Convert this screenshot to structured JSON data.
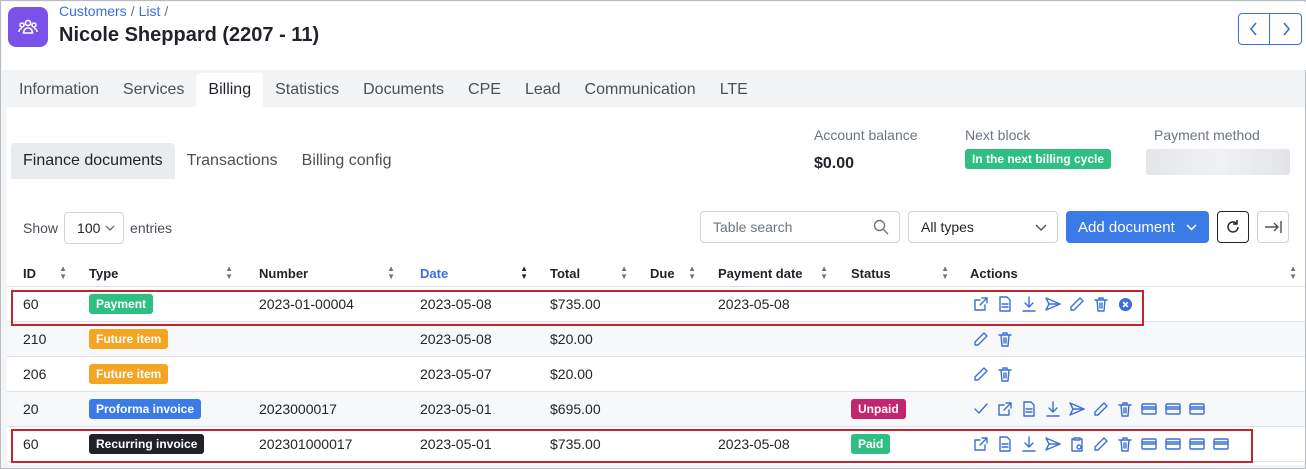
{
  "breadcrumb": [
    "Customers",
    "List"
  ],
  "page_title": "Nicole Sheppard (2207 - 11)",
  "tabs": [
    {
      "label": "Information",
      "active": false
    },
    {
      "label": "Services",
      "active": false
    },
    {
      "label": "Billing",
      "active": true
    },
    {
      "label": "Statistics",
      "active": false
    },
    {
      "label": "Documents",
      "active": false
    },
    {
      "label": "CPE",
      "active": false
    },
    {
      "label": "Lead",
      "active": false
    },
    {
      "label": "Communication",
      "active": false
    },
    {
      "label": "LTE",
      "active": false
    }
  ],
  "subtabs": [
    {
      "label": "Finance documents",
      "active": true
    },
    {
      "label": "Transactions",
      "active": false
    },
    {
      "label": "Billing config",
      "active": false
    }
  ],
  "account": {
    "balance_label": "Account balance",
    "balance": "$0.00",
    "next_block_label": "Next block",
    "next_block": "In the next billing cycle",
    "payment_method_label": "Payment method"
  },
  "controls": {
    "show": "Show",
    "entries_value": "100",
    "entries": "entries",
    "search_placeholder": "Table search",
    "type_select": "All types",
    "add_document": "Add document"
  },
  "columns": [
    "ID",
    "Type",
    "Number",
    "Date",
    "Total",
    "Due",
    "Payment date",
    "Status",
    "Actions"
  ],
  "rows": [
    {
      "id": "60",
      "type": "Payment",
      "type_color": "#2fbf82",
      "number": "2023-01-00004",
      "date": "2023-05-08",
      "total": "$735.00",
      "due": "",
      "payment_date": "2023-05-08",
      "status": "",
      "status_color": "",
      "actions": [
        "external-link-icon",
        "pdf-icon",
        "download-icon",
        "send-icon",
        "edit-icon",
        "delete-icon",
        "cancel-circle-icon"
      ],
      "highlighted": true
    },
    {
      "id": "210",
      "type": "Future item",
      "type_color": "#f5a524",
      "number": "",
      "date": "2023-05-08",
      "total": "$20.00",
      "due": "",
      "payment_date": "",
      "status": "",
      "status_color": "",
      "actions": [
        "edit-icon",
        "delete-icon"
      ],
      "highlighted": false
    },
    {
      "id": "206",
      "type": "Future item",
      "type_color": "#f5a524",
      "number": "",
      "date": "2023-05-07",
      "total": "$20.00",
      "due": "",
      "payment_date": "",
      "status": "",
      "status_color": "",
      "actions": [
        "edit-icon",
        "delete-icon"
      ],
      "highlighted": false
    },
    {
      "id": "20",
      "type": "Proforma invoice",
      "type_color": "#3b7be8",
      "number": "2023000017",
      "date": "2023-05-01",
      "total": "$695.00",
      "due": "",
      "payment_date": "",
      "status": "Unpaid",
      "status_color": "#c2266e",
      "actions": [
        "check-icon",
        "external-link-icon",
        "pdf-icon",
        "download-icon",
        "send-icon",
        "edit-icon",
        "delete-icon",
        "card-icon",
        "card-icon",
        "card-icon"
      ],
      "highlighted": false
    },
    {
      "id": "60",
      "type": "Recurring invoice",
      "type_color": "#1f2329",
      "number": "202301000017",
      "date": "2023-05-01",
      "total": "$735.00",
      "due": "",
      "payment_date": "2023-05-08",
      "status": "Paid",
      "status_color": "#2fbf82",
      "actions": [
        "external-link-icon",
        "pdf-icon",
        "download-icon",
        "send-icon",
        "clipboard-icon",
        "edit-icon",
        "delete-icon",
        "card-icon",
        "card-icon",
        "card-icon",
        "card-icon"
      ],
      "highlighted": true
    }
  ]
}
